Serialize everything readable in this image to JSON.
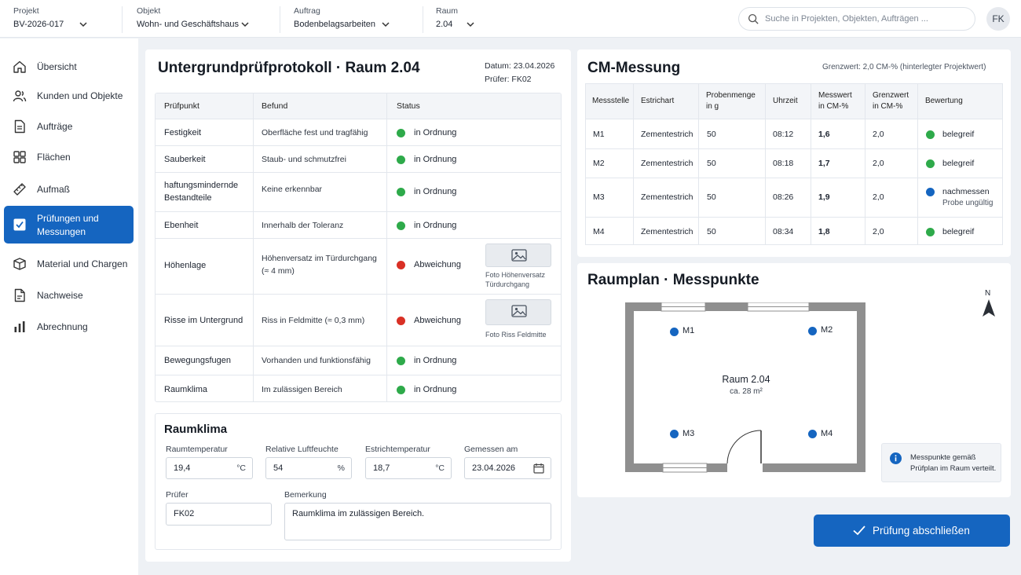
{
  "topbar": {
    "projekt": {
      "label": "Projekt",
      "value": "BV-2026-017"
    },
    "objekt": {
      "label": "Objekt",
      "value": "Wohn- und Geschäftshaus"
    },
    "auftrag": {
      "label": "Auftrag",
      "value": "Bodenbelagsarbeiten"
    },
    "raum": {
      "label": "Raum",
      "value": "2.04"
    },
    "search_placeholder": "Suche in Projekten, Objekten, Aufträgen ...",
    "user_initials": "FK"
  },
  "sidebar": {
    "items": [
      {
        "label": "Übersicht",
        "icon": "home-icon"
      },
      {
        "label": "Kunden und Objekte",
        "icon": "users-icon"
      },
      {
        "label": "Aufträge",
        "icon": "document-icon"
      },
      {
        "label": "Flächen",
        "icon": "grid-icon"
      },
      {
        "label": "Aufmaß",
        "icon": "ruler-icon"
      },
      {
        "label": "Prüfungen und",
        "label2": "Messungen",
        "icon": "checkbox-icon",
        "active": true
      },
      {
        "label": "Material und Chargen",
        "icon": "box-icon"
      },
      {
        "label": "Nachweise",
        "icon": "file-icon"
      },
      {
        "label": "Abrechnung",
        "icon": "bar-chart-icon"
      }
    ]
  },
  "protocol": {
    "title": "Untergrundprüfprotokoll · Raum 2.04",
    "date": "Datum: 23.04.2026",
    "inspector": "Prüfer: FK02",
    "headers": [
      "Prüfpunkt",
      "Befund",
      "Status"
    ],
    "rows": [
      {
        "point": "Festigkeit",
        "finding": "Oberfläche fest und tragfähig",
        "status": "in Ordnung"
      },
      {
        "point": "Sauberkeit",
        "finding": "Staub- und schmutzfrei",
        "status": "in Ordnung"
      },
      {
        "point": "haftungsmindernde",
        "point2": "Bestandteile",
        "finding": "Keine erkennbar",
        "status": "in Ordnung"
      },
      {
        "point": "Ebenheit",
        "finding": "Innerhalb der Toleranz",
        "status": "in Ordnung"
      },
      {
        "point": "Höhenlage",
        "finding": "Höhenversatz im Türdurchgang",
        "finding2": "(≈ 4 mm)",
        "status": "Abweichung",
        "photo1": "Foto Höhenversatz",
        "photo2": "Türdurchgang"
      },
      {
        "point": "Risse im Untergrund",
        "finding": "Riss in Feldmitte (≈ 0,3 mm)",
        "status": "Abweichung",
        "photo1": "Foto Riss Feldmitte"
      },
      {
        "point": "Bewegungsfugen",
        "finding": "Vorhanden und funktionsfähig",
        "status": "in Ordnung"
      },
      {
        "point": "Raumklima",
        "finding": "Im zulässigen Bereich",
        "status": "in Ordnung"
      }
    ],
    "colors": {
      "ok": "#2eaa4a",
      "deviation": "#d93025"
    }
  },
  "climate": {
    "title": "Raumklima",
    "room_temp": {
      "label": "Raumtemperatur",
      "value": "19,4",
      "unit": "°C"
    },
    "humidity": {
      "label": "Relative Luftfeuchte",
      "value": "54",
      "unit": "%"
    },
    "screed_temp": {
      "label": "Estrichtemperatur",
      "value": "18,7",
      "unit": "°C"
    },
    "measured_at": {
      "label": "Gemessen am",
      "value": "23.04.2026"
    },
    "inspector": {
      "label": "Prüfer",
      "value": "FK02"
    },
    "remark": {
      "label": "Bemerkung",
      "value": "Raumklima im zulässigen Bereich."
    }
  },
  "cm": {
    "title": "CM-Messung",
    "limit_note": "Grenzwert: 2,0 CM-% (hinterlegter Projektwert)",
    "headers": [
      {
        "l1": "Messstelle",
        "l2": ""
      },
      {
        "l1": "Estrichart",
        "l2": ""
      },
      {
        "l1": "Probenmenge",
        "l2": "in g"
      },
      {
        "l1": "Uhrzeit",
        "l2": ""
      },
      {
        "l1": "Messwert",
        "l2": "in CM-%"
      },
      {
        "l1": "Grenzwert",
        "l2": "in CM-%"
      },
      {
        "l1": "Bewertung",
        "l2": ""
      }
    ],
    "rows": [
      {
        "id": "M1",
        "type": "Zementestrich",
        "amount": "50",
        "time": "08:12",
        "value": "1,6",
        "limit": "2,0",
        "rating": "belegreif",
        "note": ""
      },
      {
        "id": "M2",
        "type": "Zementestrich",
        "amount": "50",
        "time": "08:18",
        "value": "1,7",
        "limit": "2,0",
        "rating": "belegreif",
        "note": ""
      },
      {
        "id": "M3",
        "type": "Zementestrich",
        "amount": "50",
        "time": "08:26",
        "value": "1,9",
        "limit": "2,0",
        "rating": "nachmessen",
        "note": "Probe ungültig"
      },
      {
        "id": "M4",
        "type": "Zementestrich",
        "amount": "50",
        "time": "08:34",
        "value": "1,8",
        "limit": "2,0",
        "rating": "belegreif",
        "note": ""
      }
    ],
    "colors": {
      "ok": "#2eaa4a",
      "remeasure": "#1565c0"
    }
  },
  "plan": {
    "title": "Raumplan · Messpunkte",
    "room_name": "Raum 2.04",
    "room_area": "ca. 28 m²",
    "points": [
      "M1",
      "M2",
      "M3",
      "M4"
    ],
    "north": "N",
    "info": "Messpunkte gemäß",
    "info2": "Prüfplan im Raum verteilt."
  },
  "actions": {
    "finish": "Prüfung abschließen"
  },
  "accent": "#1565c0"
}
